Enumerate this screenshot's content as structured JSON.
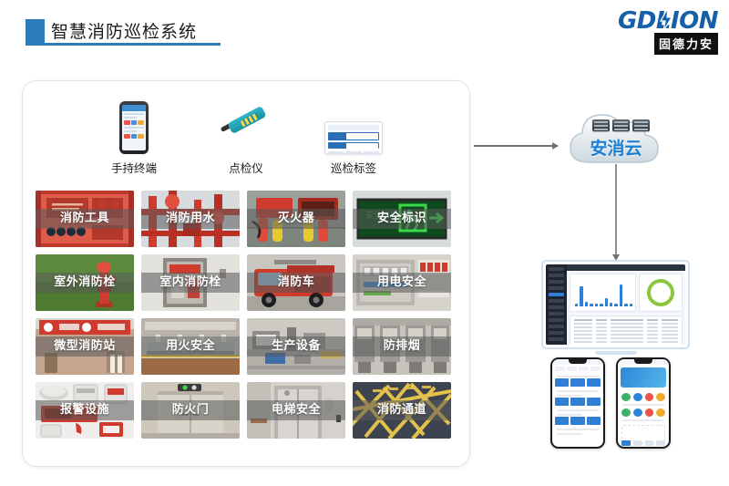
{
  "header": {
    "title": "智慧消防巡检系统",
    "accent_color": "#2b7cb8",
    "logo": {
      "text": "GDLION",
      "subtext": "固德力安",
      "bolt_icon": "lightning-bolt-icon",
      "color": "#1560a8"
    }
  },
  "devices": [
    {
      "label": "手持终端",
      "icon": "handheld-terminal-icon"
    },
    {
      "label": "点检仪",
      "icon": "inspection-wand-icon"
    },
    {
      "label": "巡检标签",
      "icon": "inspection-tag-icon"
    }
  ],
  "inspection_items": [
    [
      {
        "label": "消防工具"
      },
      {
        "label": "消防用水"
      },
      {
        "label": "灭火器"
      },
      {
        "label": "安全标识"
      }
    ],
    [
      {
        "label": "室外消防栓"
      },
      {
        "label": "室内消防栓"
      },
      {
        "label": "消防车"
      },
      {
        "label": "用电安全"
      }
    ],
    [
      {
        "label": "微型消防站"
      },
      {
        "label": "用火安全"
      },
      {
        "label": "生产设备"
      },
      {
        "label": "防排烟"
      }
    ],
    [
      {
        "label": "报警设施"
      },
      {
        "label": "防火门"
      },
      {
        "label": "电梯安全"
      },
      {
        "label": "消防通道"
      }
    ]
  ],
  "cloud": {
    "label": "安消云",
    "icon": "cloud-icon",
    "server_icon": "server-rack-icon",
    "label_color": "#1a7fd4"
  },
  "connectors": {
    "devices_to_cloud": "arrow-right",
    "cloud_to_platform": "arrow-down"
  },
  "platform": {
    "monitor_icon": "desktop-monitor-icon",
    "chart_accent": "#2f7fd6",
    "donut_accent": "#8cc63f"
  },
  "mobile": {
    "phone_left_icon": "smartphone-list-view-icon",
    "phone_right_icon": "smartphone-home-view-icon"
  }
}
